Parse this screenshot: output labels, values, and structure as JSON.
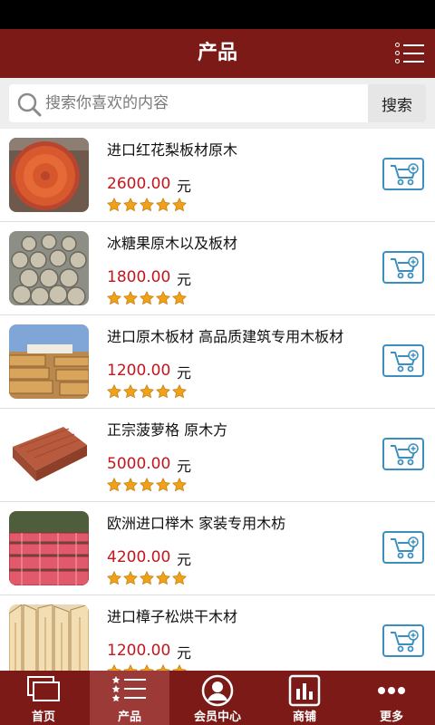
{
  "header": {
    "title": "产品",
    "menu_icon": "list-menu-icon"
  },
  "search": {
    "placeholder": "搜索你喜欢的内容",
    "value": "",
    "button_label": "搜索"
  },
  "products": [
    {
      "name": "进口红花梨板材原木",
      "price": "2600.00",
      "unit": "元",
      "rating": 5,
      "thumb": "red-log-cross-section"
    },
    {
      "name": "冰糖果原木以及板材",
      "price": "1800.00",
      "unit": "元",
      "rating": 5,
      "thumb": "pile-of-logs"
    },
    {
      "name": "进口原木板材 高品质建筑专用木板材",
      "price": "1200.00",
      "unit": "元",
      "rating": 5,
      "thumb": "lumber-yard-stacks"
    },
    {
      "name": "正宗菠萝格 原木方",
      "price": "5000.00",
      "unit": "元",
      "rating": 5,
      "thumb": "red-wood-plank"
    },
    {
      "name": "欧洲进口榉木 家装专用木枋",
      "price": "4200.00",
      "unit": "元",
      "rating": 5,
      "thumb": "beech-lumber-stack"
    },
    {
      "name": "进口樟子松烘干木材",
      "price": "1200.00",
      "unit": "元",
      "rating": 5,
      "thumb": "pine-boards"
    }
  ],
  "tabs": [
    {
      "label": "首页",
      "icon": "home-screens-icon",
      "active": false
    },
    {
      "label": "产品",
      "icon": "star-list-icon",
      "active": true
    },
    {
      "label": "会员中心",
      "icon": "user-circle-icon",
      "active": false
    },
    {
      "label": "商铺",
      "icon": "bar-chart-icon",
      "active": false
    },
    {
      "label": "更多",
      "icon": "more-dots-icon",
      "active": false
    }
  ],
  "colors": {
    "header_bg": "#7b1a17",
    "price": "#c4161c",
    "cart_border": "#3b8fc0",
    "star": "#f0a11a"
  }
}
